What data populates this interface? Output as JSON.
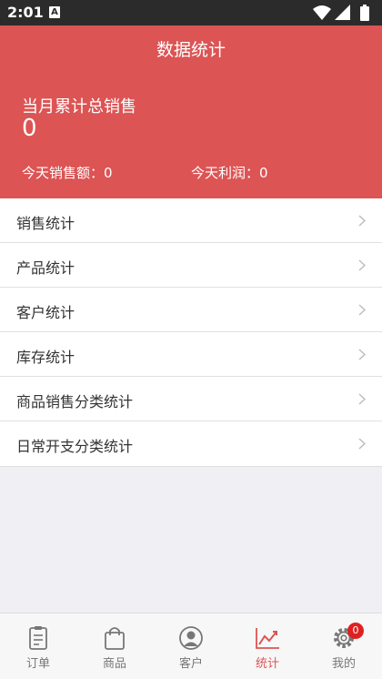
{
  "status": {
    "time": "2:01",
    "notification_glyph": "A"
  },
  "header": {
    "title": "数据统计",
    "month_label": "当月累计总销售",
    "month_value": "0",
    "today_sales": "今天销售额：0",
    "today_profit": "今天利润：0"
  },
  "list": [
    {
      "label": "销售统计"
    },
    {
      "label": "产品统计"
    },
    {
      "label": "客户统计"
    },
    {
      "label": "库存统计"
    },
    {
      "label": "商品销售分类统计"
    },
    {
      "label": "日常开支分类统计"
    }
  ],
  "tabs": [
    {
      "label": "订单",
      "icon": "order-clipboard-icon"
    },
    {
      "label": "商品",
      "icon": "shopping-bag-icon"
    },
    {
      "label": "客户",
      "icon": "customer-person-icon"
    },
    {
      "label": "统计",
      "icon": "statistics-chart-icon",
      "active": true
    },
    {
      "label": "我的",
      "icon": "gear-icon",
      "badge": "0"
    }
  ],
  "colors": {
    "accent": "#dc5454",
    "status_bar": "#2b2b2b",
    "badge": "#e02020"
  }
}
